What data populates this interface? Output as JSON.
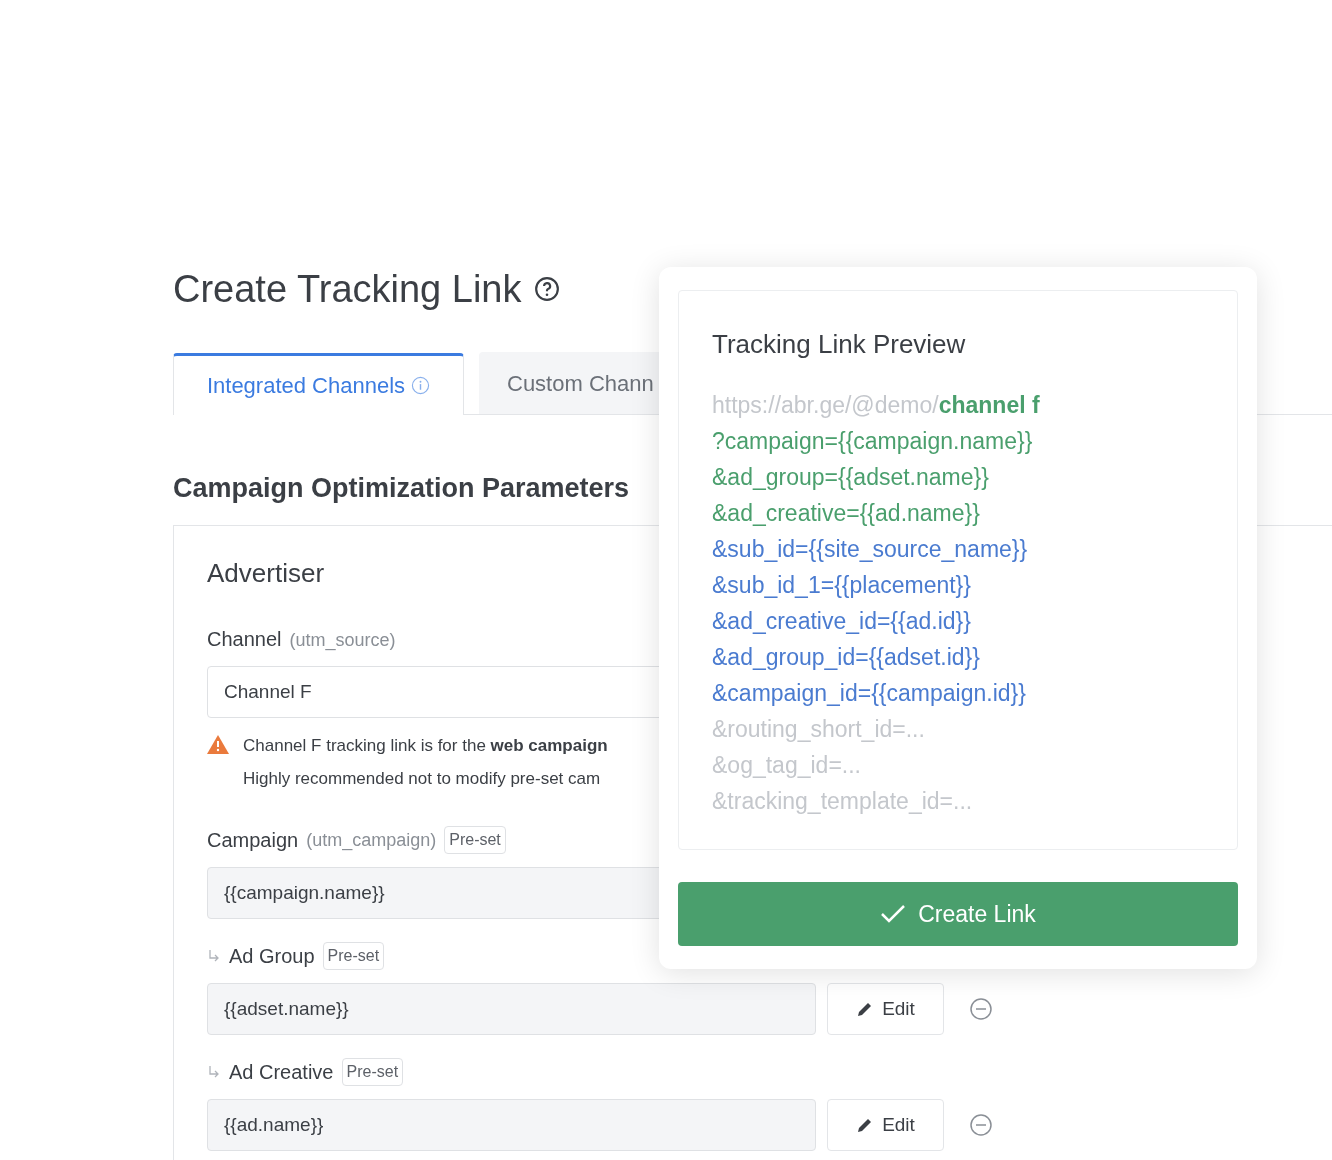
{
  "page": {
    "title": "Create Tracking Link"
  },
  "tabs": [
    {
      "label": "Integrated Channels",
      "selected": true,
      "info": true
    },
    {
      "label": "Custom Chann",
      "selected": false,
      "info": false
    }
  ],
  "section_title": "Campaign Optimization Parameters",
  "advertiser": {
    "title": "Advertiser",
    "channel": {
      "label": "Channel",
      "hint": "(utm_source)",
      "value": "Channel F"
    },
    "warning": [
      "Channel F tracking link is for the **web campaign**",
      "Highly recommended not to modify pre-set cam"
    ]
  },
  "fields": [
    {
      "kind": "top",
      "label": "Campaign",
      "hint": "(utm_campaign)",
      "badge": "Pre-set",
      "value": "{{campaign.name}}"
    },
    {
      "kind": "sub",
      "label": "Ad Group",
      "badge": "Pre-set",
      "value": "{{adset.name}}",
      "edit": "Edit"
    },
    {
      "kind": "sub",
      "label": "Ad Creative",
      "badge": "Pre-set",
      "value": "{{ad.name}}",
      "edit": "Edit"
    }
  ],
  "preview": {
    "title": "Tracking Link Preview",
    "lines": [
      {
        "parts": [
          {
            "text": "https://abr.ge/@demo/",
            "color": "#c4c7cc"
          },
          {
            "text": "**channel f**",
            "color": "#4a9f6d"
          }
        ]
      },
      {
        "parts": [
          {
            "text": "?campaign={{campaign.name}}",
            "color": "#4a9f6d"
          }
        ]
      },
      {
        "parts": [
          {
            "text": "&ad_group={{adset.name}}",
            "color": "#4a9f6d"
          }
        ]
      },
      {
        "parts": [
          {
            "text": "&ad_creative={{ad.name}}",
            "color": "#4a9f6d"
          }
        ]
      },
      {
        "parts": [
          {
            "text": "&sub_id={{site_source_name}}",
            "color": "#4a7bd0"
          }
        ]
      },
      {
        "parts": [
          {
            "text": "&sub_id_1={{placement}}",
            "color": "#4a7bd0"
          }
        ]
      },
      {
        "parts": [
          {
            "text": "&ad_creative_id={{ad.id}}",
            "color": "#4a7bd0"
          }
        ]
      },
      {
        "parts": [
          {
            "text": "&ad_group_id={{adset.id}}",
            "color": "#4a7bd0"
          }
        ]
      },
      {
        "parts": [
          {
            "text": "&campaign_id={{campaign.id}}",
            "color": "#4a7bd0"
          }
        ]
      },
      {
        "parts": [
          {
            "text": "&routing_short_id=...",
            "color": "#c4c7cc"
          }
        ]
      },
      {
        "parts": [
          {
            "text": "&og_tag_id=...",
            "color": "#c4c7cc"
          }
        ]
      },
      {
        "parts": [
          {
            "text": "&tracking_template_id=...",
            "color": "#c4c7cc"
          }
        ]
      }
    ],
    "button": "Create Link"
  }
}
